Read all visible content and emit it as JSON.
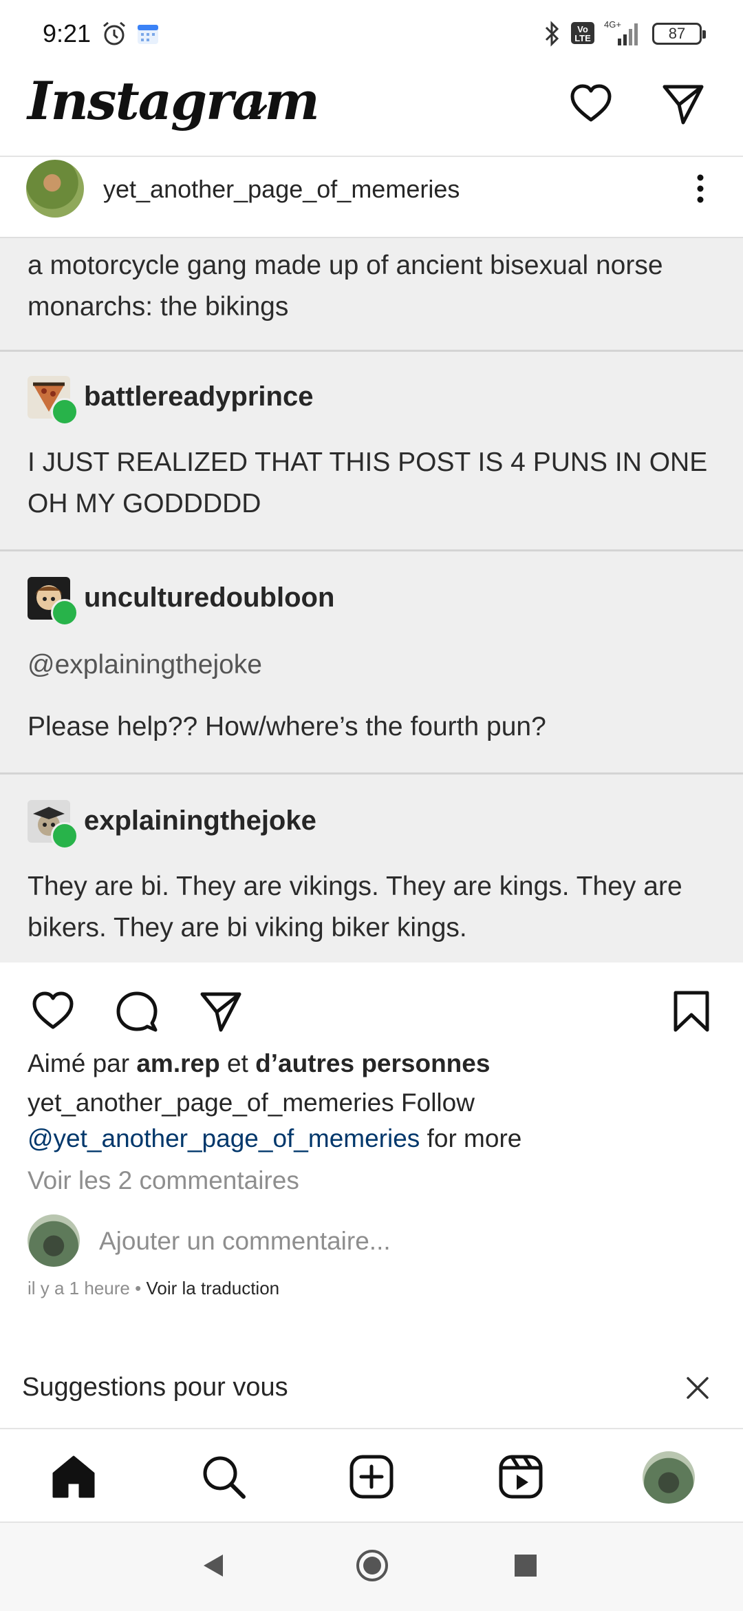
{
  "status_bar": {
    "time": "9:21",
    "network": "4G+",
    "volte": "Vo LTE",
    "battery": "87"
  },
  "header": {
    "logo": "Instagram"
  },
  "post": {
    "username": "yet_another_page_of_memeries",
    "tumblr": {
      "intro_text": "a motorcycle gang made up of ancient bisexual norse monarchs: the bikings",
      "replies": [
        {
          "user": "battlereadyprince",
          "text": "I JUST REALIZED THAT THIS POST IS 4 PUNS IN ONE OH MY GODDDDD"
        },
        {
          "user": "unculturedoubloon",
          "mention": "@explainingthejoke",
          "text": "Please help?? How/where’s the fourth pun?"
        },
        {
          "user": "explainingthejoke",
          "text": "They are bi. They are vikings. They are kings. They are bikers. They are bi viking biker kings."
        }
      ]
    },
    "likes": {
      "prefix": "Aimé par",
      "user": "am.rep",
      "middle": "et",
      "suffix": "d’autres personnes"
    },
    "caption": {
      "user": "yet_another_page_of_memeries",
      "text_before": "Follow",
      "mention": "@yet_another_page_of_memeries",
      "text_after": "for more"
    },
    "view_comments": "Voir les 2 commentaires",
    "comment_placeholder": "Ajouter un commentaire...",
    "time_ago": "il y a 1 heure",
    "separator": "•",
    "translate": "Voir la traduction"
  },
  "suggestions": {
    "title": "Suggestions pour vous"
  },
  "colors": {
    "reblog_badge": "#28b34a",
    "mention": "#00376b",
    "muted": "#8e8e8e",
    "image_bg": "#efefef"
  },
  "icons": [
    "alarm-icon",
    "calendar-icon",
    "bluetooth-icon",
    "signal-icon",
    "heart-icon",
    "send-icon",
    "more-icon",
    "comment-icon",
    "bookmark-icon",
    "close-icon",
    "home-icon",
    "search-icon",
    "add-post-icon",
    "reels-icon",
    "back-icon",
    "home-circle-icon",
    "recents-icon"
  ]
}
